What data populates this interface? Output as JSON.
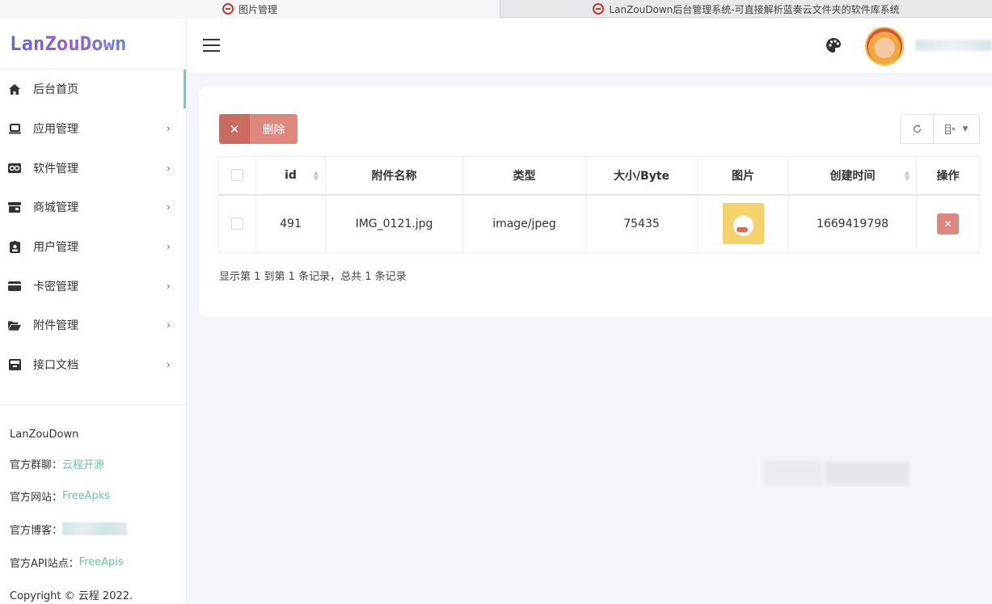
{
  "browser": {
    "tabs": [
      {
        "title": "图片管理",
        "active": true
      },
      {
        "title": "LanZouDown后台管理系统-可直接解析蓝奏云文件夹的软件库系统",
        "active": false
      }
    ]
  },
  "sidebar": {
    "logo": "LanZouDown",
    "items": [
      {
        "label": "后台首页",
        "icon": "home-icon",
        "has_submenu": false,
        "active": true
      },
      {
        "label": "应用管理",
        "icon": "laptop-icon",
        "has_submenu": true
      },
      {
        "label": "软件管理",
        "icon": "infinity-icon",
        "has_submenu": true
      },
      {
        "label": "商城管理",
        "icon": "store-icon",
        "has_submenu": true
      },
      {
        "label": "用户管理",
        "icon": "id-badge-icon",
        "has_submenu": true
      },
      {
        "label": "卡密管理",
        "icon": "credit-card-icon",
        "has_submenu": true
      },
      {
        "label": "附件管理",
        "icon": "folder-open-icon",
        "has_submenu": true
      },
      {
        "label": "接口文档",
        "icon": "inbox-icon",
        "has_submenu": true
      }
    ],
    "footer": {
      "brand": "LanZouDown",
      "group_label": "官方群聊：",
      "group_link": "云程开源",
      "site_label": "官方网站：",
      "site_link": "FreeApks",
      "blog_label": "官方博客：",
      "api_label": "官方API站点：",
      "api_link": "FreeApis",
      "copyright": "Copyright © 云程 2022."
    }
  },
  "header": {
    "menu_toggle": "hamburger-icon",
    "theme_icon": "palette-icon"
  },
  "toolbar": {
    "delete_label": "删除",
    "delete_icon": "✕"
  },
  "table": {
    "columns": [
      "id",
      "附件名称",
      "类型",
      "大小/Byte",
      "图片",
      "创建时间",
      "操作"
    ],
    "rows": [
      {
        "id": "491",
        "name": "IMG_0121.jpg",
        "type": "image/jpeg",
        "size": "75435",
        "created": "1669419798"
      }
    ]
  },
  "pagination": {
    "info": "显示第 1 到第 1 条记录，总共 1 条记录"
  },
  "colors": {
    "accent": "#7fc7b5",
    "danger": "#e0877d",
    "danger_dark": "#c96b61",
    "link": "#6cc3a7"
  }
}
